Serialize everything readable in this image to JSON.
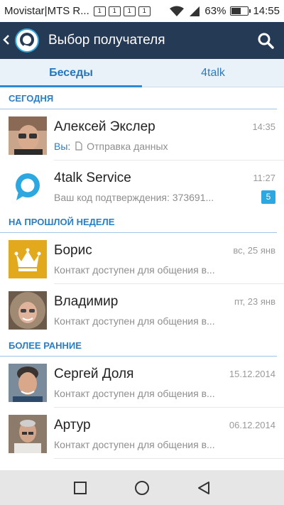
{
  "status_bar": {
    "carrier": "Movistar|MTS R...",
    "notification_icons": [
      "1",
      "1",
      "1",
      "1"
    ],
    "battery_percent": "63%",
    "battery_level": 0.63,
    "time": "14:55"
  },
  "toolbar": {
    "title": "Выбор получателя",
    "back_icon": "chevron-left-icon",
    "logo_icon": "4talk-logo-icon",
    "search_icon": "search-icon"
  },
  "tabs": [
    {
      "label": "Беседы",
      "active": true
    },
    {
      "label": "4talk",
      "active": false
    }
  ],
  "sections": {
    "today": "СЕГОДНЯ",
    "last_week": "НА ПРОШЛОЙ НЕДЕЛЕ",
    "earlier": "БОЛЕЕ РАННИЕ"
  },
  "conversations": [
    {
      "name": "Алексей Экслер",
      "time": "14:35",
      "you_prefix": "Вы:",
      "preview": "Отправка данных",
      "avatar": "photo"
    },
    {
      "name": "4talk Service",
      "time": "11:27",
      "preview": "Ваш код подтверждения: 373691...",
      "badge": "5",
      "avatar": "4talk-logo"
    },
    {
      "name": "Борис",
      "time": "вс, 25 янв",
      "preview": "Контакт доступен для общения в...",
      "avatar": "crown"
    },
    {
      "name": "Владимир",
      "time": "пт, 23 янв",
      "preview": "Контакт доступен для общения в...",
      "avatar": "photo"
    },
    {
      "name": "Сергей Доля",
      "time": "15.12.2014",
      "preview": "Контакт доступен для общения в...",
      "avatar": "photo"
    },
    {
      "name": "Артур",
      "time": "06.12.2014",
      "preview": "Контакт доступен для общения в...",
      "avatar": "photo"
    }
  ],
  "colors": {
    "toolbar": "#253a55",
    "accent": "#2a7ec4",
    "badge": "#2ca7e0",
    "crown_bg": "#e3a91c"
  }
}
